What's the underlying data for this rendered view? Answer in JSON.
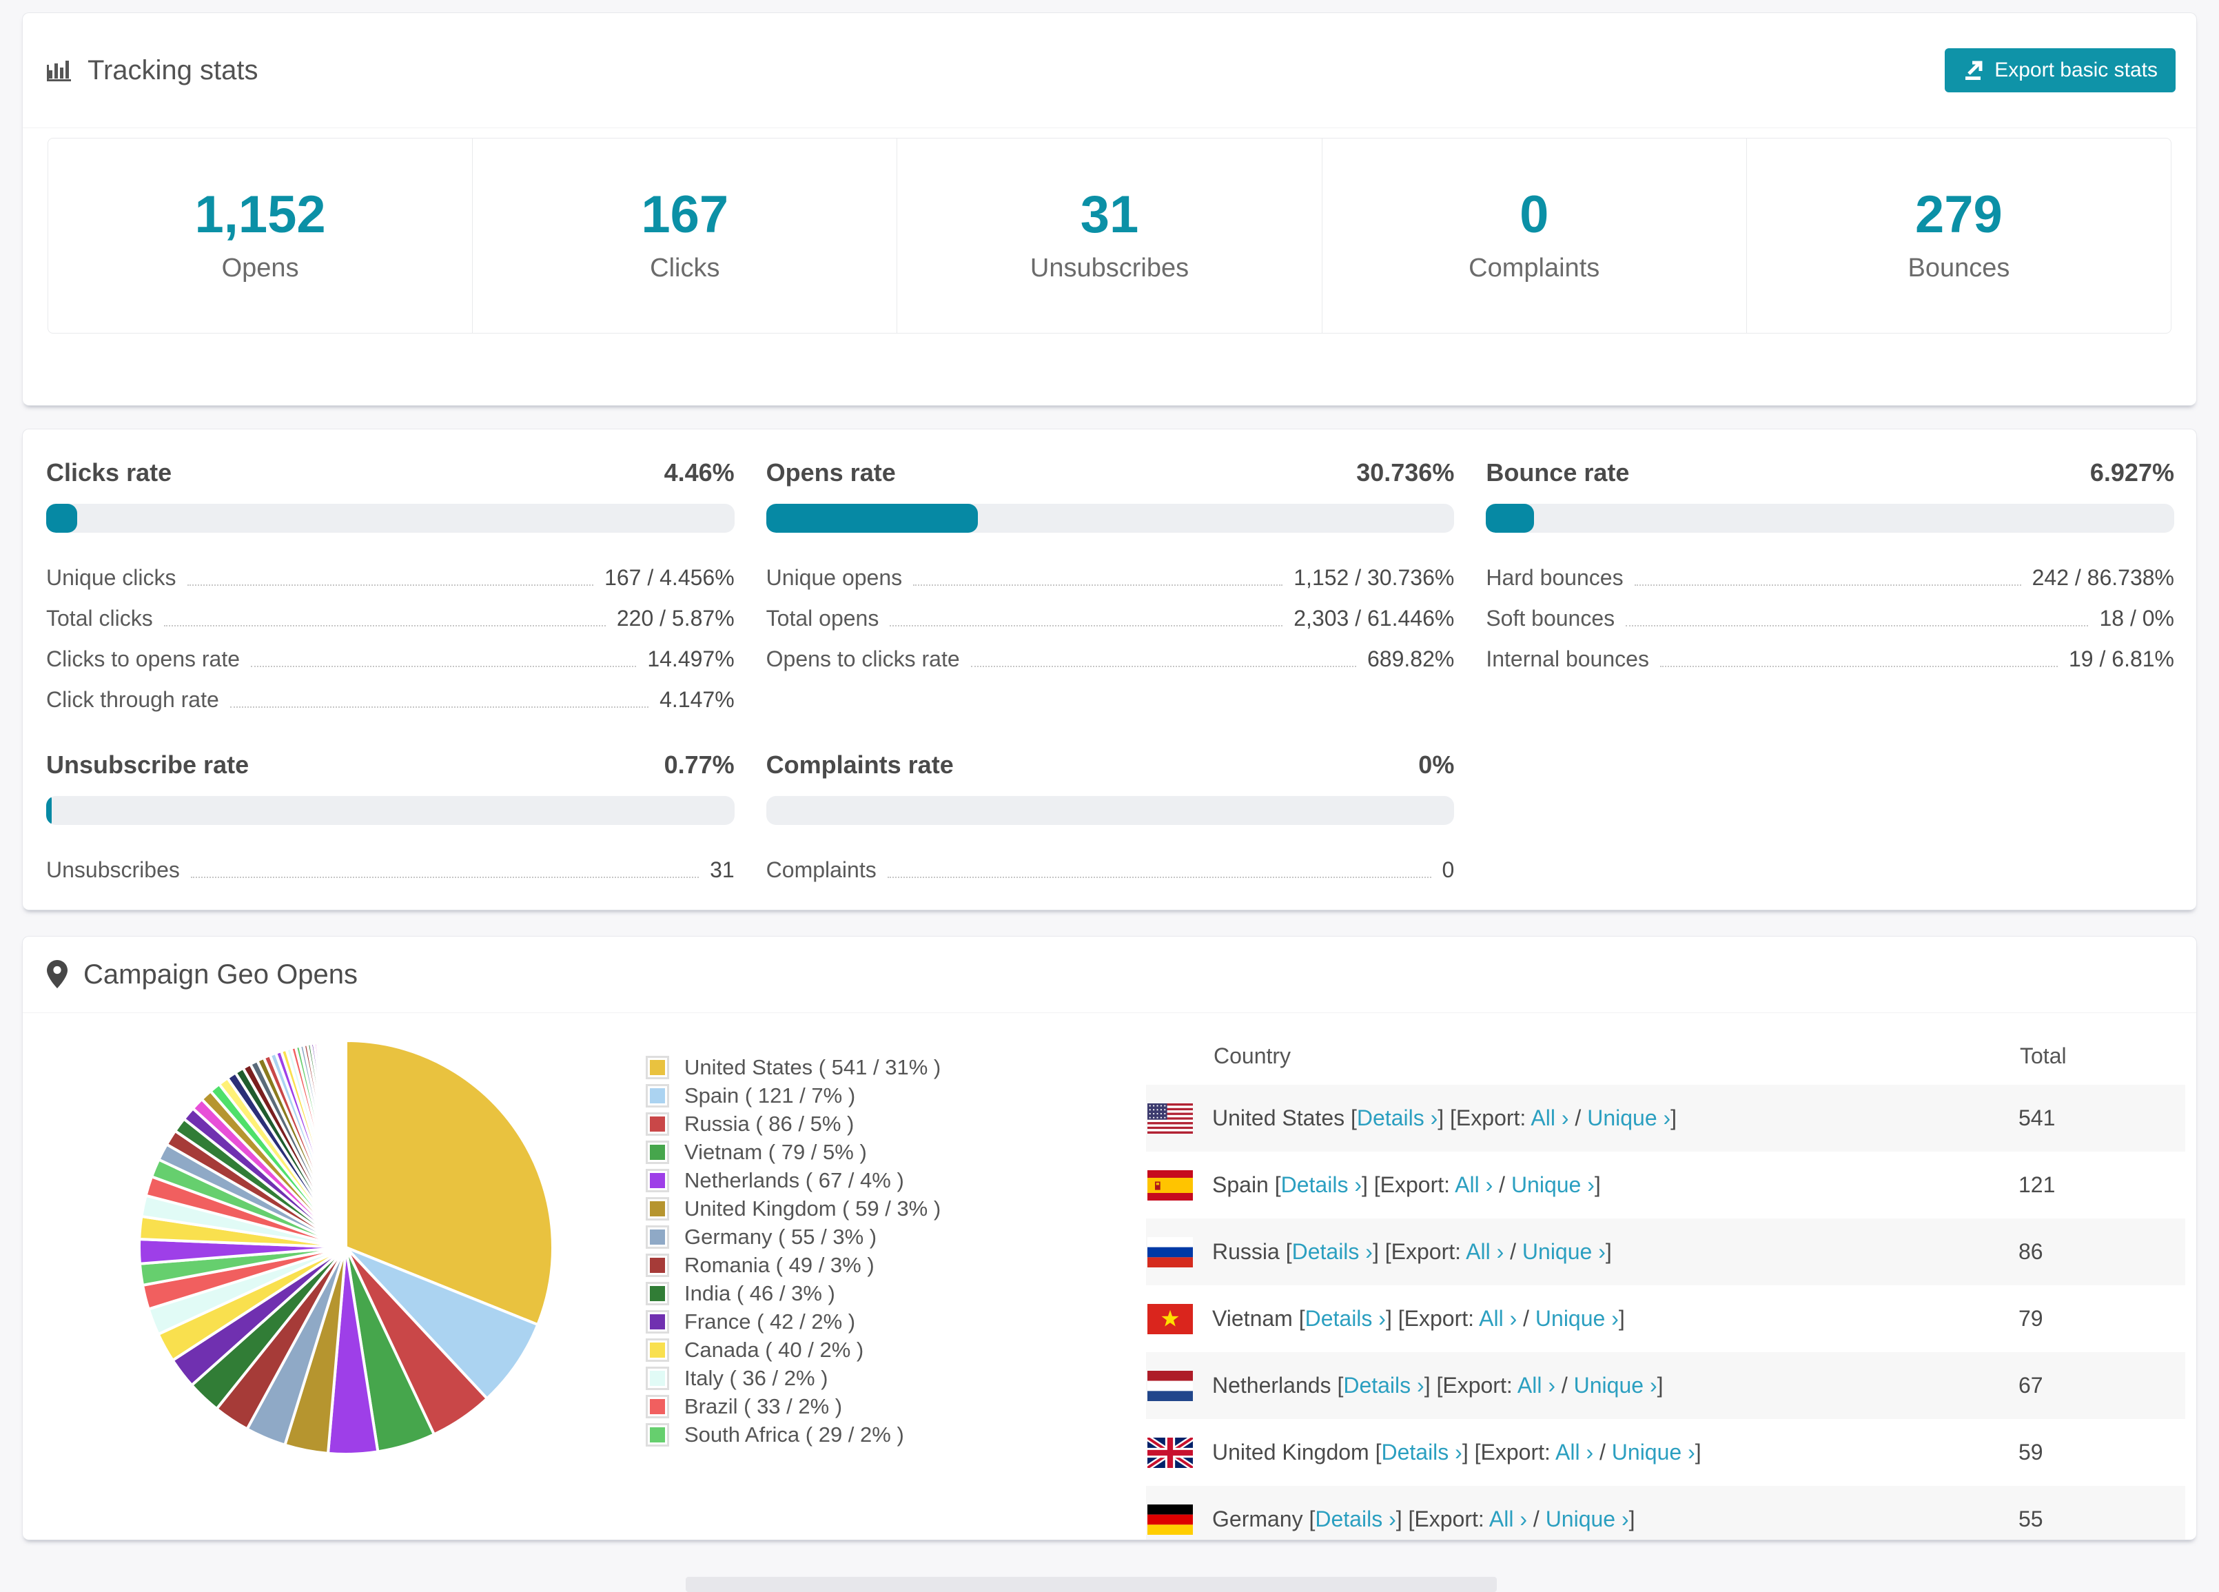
{
  "colors": {
    "accent": "#0b90a6",
    "button": "#0f93a8",
    "link": "#2b9fc0",
    "progress_track": "#edeff2",
    "zebra_row": "#f7f7f7",
    "page_bg": "#f7f7f9"
  },
  "tracking": {
    "title": "Tracking stats",
    "export_label": "Export basic stats",
    "stats": [
      {
        "value": "1,152",
        "label": "Opens"
      },
      {
        "value": "167",
        "label": "Clicks"
      },
      {
        "value": "31",
        "label": "Unsubscribes"
      },
      {
        "value": "0",
        "label": "Complaints"
      },
      {
        "value": "279",
        "label": "Bounces"
      }
    ]
  },
  "rates": {
    "blocks": [
      {
        "title": "Clicks rate",
        "value": "4.46%",
        "percent": 4.46,
        "rows": [
          {
            "label": "Unique clicks",
            "value": "167 / 4.456%"
          },
          {
            "label": "Total clicks",
            "value": "220 / 5.87%"
          },
          {
            "label": "Clicks to opens rate",
            "value": "14.497%"
          },
          {
            "label": "Click through rate",
            "value": "4.147%"
          }
        ]
      },
      {
        "title": "Opens rate",
        "value": "30.736%",
        "percent": 30.736,
        "rows": [
          {
            "label": "Unique opens",
            "value": "1,152 / 30.736%"
          },
          {
            "label": "Total opens",
            "value": "2,303 / 61.446%"
          },
          {
            "label": "Opens to clicks rate",
            "value": "689.82%"
          }
        ]
      },
      {
        "title": "Bounce rate",
        "value": "6.927%",
        "percent": 6.927,
        "rows": [
          {
            "label": "Hard bounces",
            "value": "242 / 86.738%"
          },
          {
            "label": "Soft bounces",
            "value": "18 / 0%"
          },
          {
            "label": "Internal bounces",
            "value": "19 / 6.81%"
          }
        ]
      },
      {
        "title": "Unsubscribe rate",
        "value": "0.77%",
        "percent": 0.77,
        "rows": [
          {
            "label": "Unsubscribes",
            "value": "31"
          }
        ]
      },
      {
        "title": "Complaints rate",
        "value": "0%",
        "percent": 0,
        "rows": [
          {
            "label": "Complaints",
            "value": "0"
          }
        ]
      }
    ]
  },
  "geo": {
    "title": "Campaign Geo Opens",
    "legend": [
      {
        "country": "United States",
        "count": "541",
        "pct": "31",
        "color": "#e9c23f"
      },
      {
        "country": "Spain",
        "count": "121",
        "pct": "7",
        "color": "#abd3f1"
      },
      {
        "country": "Russia",
        "count": "86",
        "pct": "5",
        "color": "#c94748"
      },
      {
        "country": "Vietnam",
        "count": "79",
        "pct": "5",
        "color": "#46a64c"
      },
      {
        "country": "Netherlands",
        "count": "67",
        "pct": "4",
        "color": "#9e3fe8"
      },
      {
        "country": "United Kingdom",
        "count": "59",
        "pct": "3",
        "color": "#b6952f"
      },
      {
        "country": "Germany",
        "count": "55",
        "pct": "3",
        "color": "#8fa9c6"
      },
      {
        "country": "Romania",
        "count": "49",
        "pct": "3",
        "color": "#a63b38"
      },
      {
        "country": "India",
        "count": "46",
        "pct": "3",
        "color": "#317d36"
      },
      {
        "country": "France",
        "count": "42",
        "pct": "2",
        "color": "#7030b0"
      },
      {
        "country": "Canada",
        "count": "40",
        "pct": "2",
        "color": "#f9e04e"
      },
      {
        "country": "Italy",
        "count": "36",
        "pct": "2",
        "color": "#e1fbf6"
      },
      {
        "country": "Brazil",
        "count": "33",
        "pct": "2",
        "color": "#f15f5f"
      },
      {
        "country": "South Africa",
        "count": "29",
        "pct": "2",
        "color": "#66cf6e"
      }
    ],
    "table": {
      "headers": [
        "Country",
        "Total"
      ],
      "link_labels": {
        "details": "Details",
        "export": "Export:",
        "all": "All",
        "unique": "Unique",
        "arrow": "›"
      },
      "rows": [
        {
          "flag": "us",
          "country": "United States",
          "total": "541"
        },
        {
          "flag": "es",
          "country": "Spain",
          "total": "121"
        },
        {
          "flag": "ru",
          "country": "Russia",
          "total": "86"
        },
        {
          "flag": "vn",
          "country": "Vietnam",
          "total": "79"
        },
        {
          "flag": "nl",
          "country": "Netherlands",
          "total": "67"
        },
        {
          "flag": "gb",
          "country": "United Kingdom",
          "total": "59"
        },
        {
          "flag": "de",
          "country": "Germany",
          "total": "55"
        }
      ]
    },
    "pie": {
      "others_count": 48,
      "others_start": 33,
      "others_decay": 0.93,
      "others_palette": [
        "#9e3fe8",
        "#f9e04e",
        "#e1fbf6",
        "#f15f5f",
        "#66cf6e",
        "#8fa9c6",
        "#a63b38",
        "#317d36",
        "#7030b0",
        "#e84fd8",
        "#b6952f",
        "#4fe06a",
        "#fff176",
        "#2b2f77",
        "#1f5c2e",
        "#7a1f1f",
        "#5a6b7a",
        "#8a7a1e",
        "#c94748",
        "#abd3f1"
      ]
    }
  },
  "chart_data": {
    "type": "pie",
    "title": "Campaign Geo Opens",
    "legend_position": "right",
    "categories": [
      "United States",
      "Spain",
      "Russia",
      "Vietnam",
      "Netherlands",
      "United Kingdom",
      "Germany",
      "Romania",
      "India",
      "France",
      "Canada",
      "Italy",
      "Brazil",
      "South Africa",
      "Other countries (many small unlabeled slices, aggregated)"
    ],
    "values": [
      541,
      121,
      86,
      79,
      67,
      59,
      55,
      49,
      46,
      42,
      40,
      36,
      33,
      29,
      460
    ],
    "percent_labels": [
      31,
      7,
      5,
      5,
      4,
      3,
      3,
      3,
      3,
      2,
      2,
      2,
      2,
      2,
      null
    ],
    "colors": [
      "#e9c23f",
      "#abd3f1",
      "#c94748",
      "#46a64c",
      "#9e3fe8",
      "#b6952f",
      "#8fa9c6",
      "#a63b38",
      "#317d36",
      "#7030b0",
      "#f9e04e",
      "#e1fbf6",
      "#f15f5f",
      "#66cf6e",
      "mixed"
    ],
    "units": "opens"
  }
}
